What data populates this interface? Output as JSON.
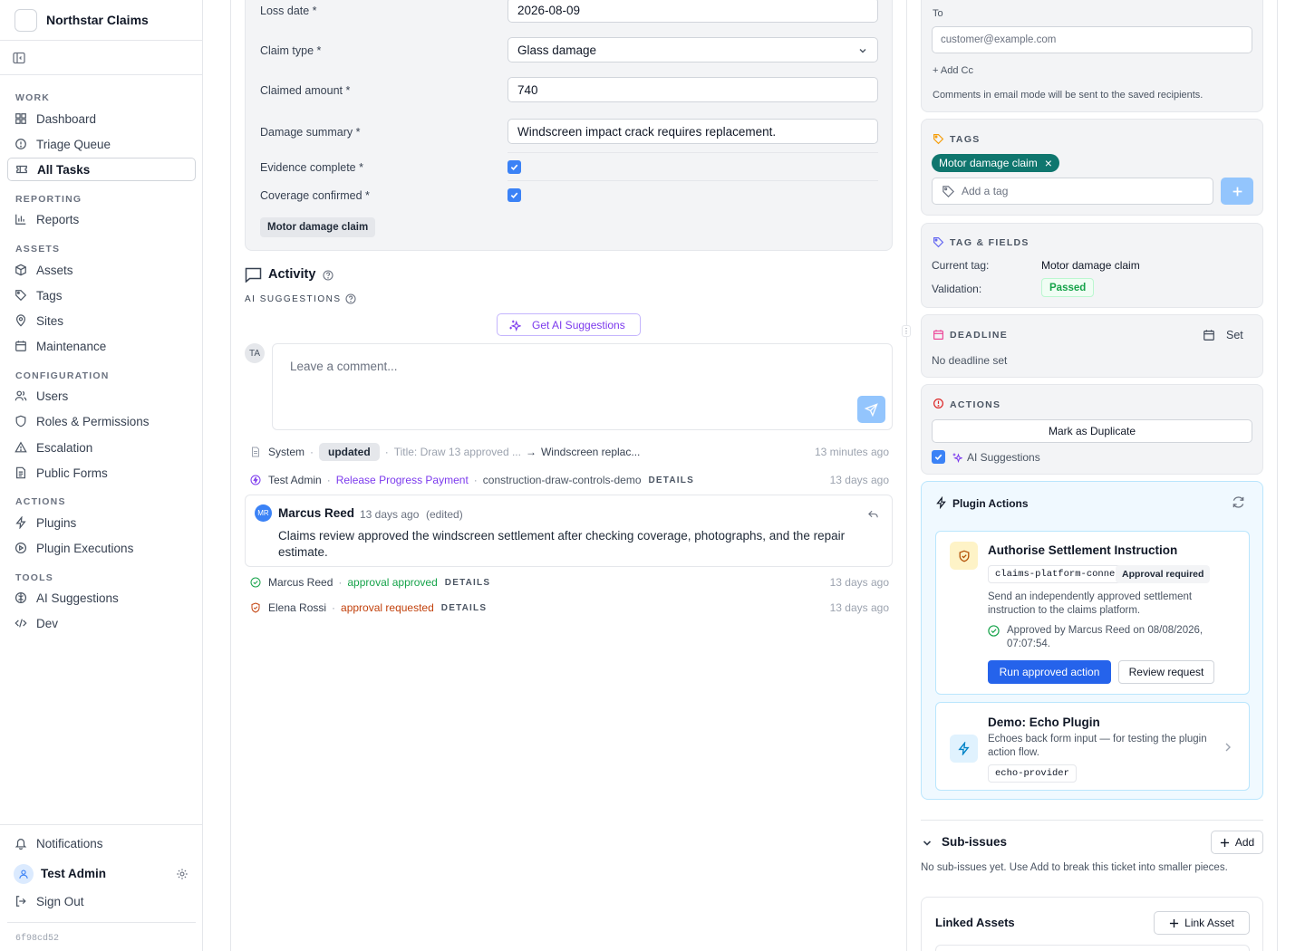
{
  "app": {
    "name": "Northstar Claims",
    "build_id": "6f98cd52"
  },
  "sidebar": {
    "sections": [
      {
        "label": "WORK",
        "items": [
          {
            "label": "Dashboard",
            "icon": "grid-icon"
          },
          {
            "label": "Triage Queue",
            "icon": "alert-circle-icon"
          },
          {
            "label": "All Tasks",
            "icon": "ticket-icon",
            "active": true
          }
        ]
      },
      {
        "label": "REPORTING",
        "items": [
          {
            "label": "Reports",
            "icon": "bar-chart-icon"
          }
        ]
      },
      {
        "label": "ASSETS",
        "items": [
          {
            "label": "Assets",
            "icon": "box-icon"
          },
          {
            "label": "Tags",
            "icon": "tag-icon"
          },
          {
            "label": "Sites",
            "icon": "map-pin-icon"
          },
          {
            "label": "Maintenance",
            "icon": "calendar-icon"
          }
        ]
      },
      {
        "label": "CONFIGURATION",
        "items": [
          {
            "label": "Users",
            "icon": "users-icon"
          },
          {
            "label": "Roles & Permissions",
            "icon": "shield-icon"
          },
          {
            "label": "Escalation",
            "icon": "warning-triangle-icon"
          },
          {
            "label": "Public Forms",
            "icon": "file-text-icon"
          }
        ]
      },
      {
        "label": "ACTIONS",
        "items": [
          {
            "label": "Plugins",
            "icon": "lightning-icon"
          },
          {
            "label": "Plugin Executions",
            "icon": "play-circle-icon"
          }
        ]
      },
      {
        "label": "TOOLS",
        "items": [
          {
            "label": "AI Suggestions",
            "icon": "brain-icon"
          },
          {
            "label": "Dev",
            "icon": "code-icon"
          }
        ]
      }
    ],
    "notifications_label": "Notifications",
    "user_name": "Test Admin",
    "sign_out_label": "Sign Out"
  },
  "form": {
    "loss_date_label": "Loss date *",
    "loss_date_value": "2026-08-09",
    "claim_type_label": "Claim type *",
    "claim_type_value": "Glass damage",
    "claimed_amount_label": "Claimed amount *",
    "claimed_amount_value": "740",
    "damage_summary_label": "Damage summary *",
    "damage_summary_value": "Windscreen impact crack requires replacement.",
    "evidence_label": "Evidence complete *",
    "evidence_checked": true,
    "coverage_label": "Coverage confirmed *",
    "coverage_checked": true,
    "tag_chip": "Motor damage claim"
  },
  "activity": {
    "title": "Activity",
    "ai_label": "AI SUGGESTIONS",
    "ai_button": "Get AI Suggestions",
    "avatar_initials": "TA",
    "comment_placeholder": "Leave a comment...",
    "rows": {
      "r1": {
        "actor": "System",
        "action": "updated",
        "change_from": "Title: Draw 13 approved ...",
        "arrow": "→",
        "change_to": "Windscreen replac...",
        "time": "13 minutes ago"
      },
      "r2": {
        "actor": "Test Admin",
        "action": "Release Progress Payment",
        "target": "construction-draw-controls-demo",
        "details": "DETAILS",
        "time": "13 days ago"
      },
      "r4": {
        "actor": "Marcus Reed",
        "action": "approval approved",
        "details": "DETAILS",
        "time": "13 days ago"
      },
      "r5": {
        "actor": "Elena Rossi",
        "action": "approval requested",
        "details": "DETAILS",
        "time": "13 days ago"
      }
    },
    "comment": {
      "initials": "MR",
      "author": "Marcus Reed",
      "time": "13 days ago",
      "edited": "(edited)",
      "body": "Claims review approved the windscreen settlement after checking coverage, photographs, and the repair estimate."
    }
  },
  "right": {
    "email": {
      "to_label": "To",
      "to_placeholder": "customer@example.com",
      "add_cc": "+ Add Cc",
      "note": "Comments in email mode will be sent to the saved recipients."
    },
    "tags": {
      "title": "TAGS",
      "current": "Motor damage claim",
      "remove": "×",
      "input_placeholder": "Add a tag"
    },
    "tag_fields": {
      "title": "TAG & FIELDS",
      "current_label": "Current tag:",
      "current_value": "Motor damage claim",
      "validation_label": "Validation:",
      "validation_value": "Passed"
    },
    "deadline": {
      "title": "DEADLINE",
      "set_label": "Set",
      "empty": "No deadline set"
    },
    "actions": {
      "title": "ACTIONS",
      "duplicate": "Mark as Duplicate",
      "ai_toggle": "AI Suggestions",
      "ai_checked": true
    },
    "plugin_actions": {
      "title": "Plugin Actions",
      "cards": [
        {
          "title": "Authorise Settlement Instruction",
          "connector": "claims-platform-connector",
          "badge": "Approval required",
          "description": "Send an independently approved settlement instruction to the claims platform.",
          "approved_note": "Approved by Marcus Reed on 08/08/2026, 07:07:54.",
          "primary_button": "Run approved action",
          "secondary_button": "Review request"
        },
        {
          "title": "Demo: Echo Plugin",
          "description": "Echoes back form input — for testing the plugin action flow.",
          "provider": "echo-provider"
        }
      ]
    },
    "sub_issues": {
      "title": "Sub-issues",
      "add_label": "Add",
      "empty": "No sub-issues yet. Use Add to break this ticket into smaller pieces."
    },
    "linked_assets": {
      "title": "Linked Assets",
      "link_label": "Link Asset"
    }
  },
  "colors": {
    "accent": "#3b82f6",
    "primary_button": "#2563eb",
    "tag_green": "#0f766e",
    "ai_purple": "#7c3aed",
    "success": "#16a34a",
    "warning": "#c2410c"
  }
}
